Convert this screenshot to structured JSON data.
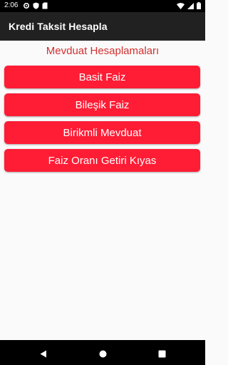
{
  "status_bar": {
    "time": "2:06",
    "icons_left": [
      "settings-icon",
      "shield-icon",
      "sd-card-icon"
    ],
    "icons_right": [
      "wifi-icon",
      "signal-icon",
      "battery-icon"
    ]
  },
  "app_bar": {
    "title": "Kredi Taksit Hesapla"
  },
  "main": {
    "section_title": "Mevduat Hesaplamaları",
    "buttons": [
      {
        "label": "Basit Faiz"
      },
      {
        "label": "Bileşik Faiz"
      },
      {
        "label": "Birikmli Mevduat"
      },
      {
        "label": "Faiz Oranı Getiri Kıyas"
      }
    ]
  },
  "nav_bar": {
    "icons": [
      "back-icon",
      "home-icon",
      "recents-icon"
    ]
  },
  "colors": {
    "accent": "#ff1c35",
    "title_red": "#d32f2f",
    "app_bar": "#212121",
    "background": "#fafafa"
  }
}
